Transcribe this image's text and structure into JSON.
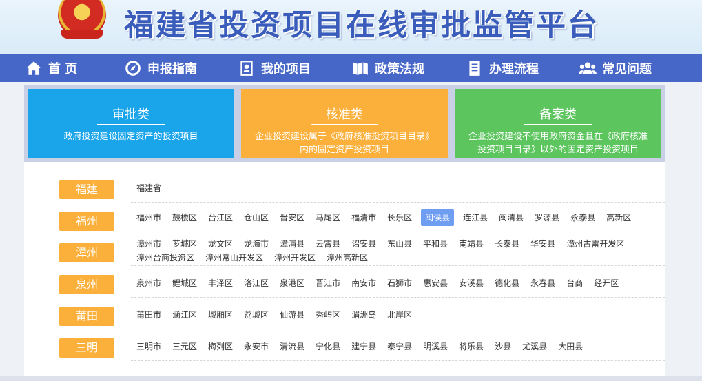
{
  "header": {
    "title": "福建省投资项目在线审批监管平台"
  },
  "nav": [
    {
      "label": "首 页",
      "icon": "home-icon"
    },
    {
      "label": "申报指南",
      "icon": "compass-icon"
    },
    {
      "label": "我的项目",
      "icon": "id-card-icon"
    },
    {
      "label": "政策法规",
      "icon": "book-icon"
    },
    {
      "label": "办理流程",
      "icon": "list-icon"
    },
    {
      "label": "常见问题",
      "icon": "users-icon"
    }
  ],
  "cards": [
    {
      "title": "审批类",
      "desc": "政府投资建设固定资产的投资项目",
      "color": "#1aa4ea"
    },
    {
      "title": "核准类",
      "desc": "企业投资建设属于《政府核准投资项目目录》内的固定资产投资项目",
      "color": "#fbb03b"
    },
    {
      "title": "备案类",
      "desc": "企业投资建设不使用政府资金且在《政府核准投资项目目录》以外的固定资产投资项目",
      "color": "#5cc55d"
    }
  ],
  "regions": [
    {
      "name": "福建",
      "cities": [
        "福建省"
      ]
    },
    {
      "name": "福州",
      "cities": [
        "福州市",
        "鼓楼区",
        "台江区",
        "仓山区",
        "晋安区",
        "马尾区",
        "福清市",
        "长乐区",
        "闽侯县",
        "连江县",
        "闽清县",
        "罗源县",
        "永泰县",
        "高新区"
      ],
      "active": "闽侯县"
    },
    {
      "name": "漳州",
      "cities": [
        "漳州市",
        "芗城区",
        "龙文区",
        "龙海市",
        "漳浦县",
        "云霄县",
        "诏安县",
        "东山县",
        "平和县",
        "南靖县",
        "长泰县",
        "华安县",
        "漳州古雷开发区",
        "漳州台商投资区",
        "漳州常山开发区",
        "漳州开发区",
        "漳州高新区"
      ]
    },
    {
      "name": "泉州",
      "cities": [
        "泉州市",
        "鲤城区",
        "丰泽区",
        "洛江区",
        "泉港区",
        "晋江市",
        "南安市",
        "石狮市",
        "惠安县",
        "安溪县",
        "德化县",
        "永春县",
        "台商",
        "经开区"
      ]
    },
    {
      "name": "莆田",
      "cities": [
        "莆田市",
        "涵江区",
        "城厢区",
        "荔城区",
        "仙游县",
        "秀屿区",
        "湄洲岛",
        "北岸区"
      ]
    },
    {
      "name": "三明",
      "cities": [
        "三明市",
        "三元区",
        "梅列区",
        "永安市",
        "清流县",
        "宁化县",
        "建宁县",
        "泰宁县",
        "明溪县",
        "将乐县",
        "沙县",
        "尤溪县",
        "大田县"
      ]
    }
  ]
}
